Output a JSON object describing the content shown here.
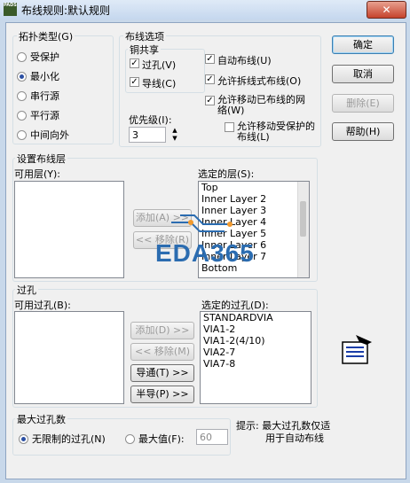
{
  "window": {
    "title": "布线规则:默认规则",
    "icon": "PADS"
  },
  "topology": {
    "title": "拓扑类型(G)",
    "options": [
      {
        "label": "受保护",
        "selected": false
      },
      {
        "label": "最小化",
        "selected": true
      },
      {
        "label": "串行源",
        "selected": false
      },
      {
        "label": "平行源",
        "selected": false
      },
      {
        "label": "中间向外",
        "selected": false
      }
    ]
  },
  "routing": {
    "title": "布线选项",
    "copper_share": {
      "title": "铜共享",
      "via_label": "过孔(V)",
      "via_checked": true,
      "trace_label": "导线(C)",
      "trace_checked": true
    },
    "priority_label": "优先级(I):",
    "priority_value": "3",
    "options": [
      {
        "label": "自动布线(U)",
        "checked": true
      },
      {
        "label": "允许拆线式布线(O)",
        "checked": true
      },
      {
        "label": "允许移动已布线的网络(W)",
        "checked": true
      },
      {
        "label": "允许移动受保护的布线(L)",
        "checked": false
      }
    ]
  },
  "buttons": {
    "ok": "确定",
    "cancel": "取消",
    "delete": "删除(E)",
    "help": "帮助(H)"
  },
  "layers": {
    "title": "设置布线层",
    "available_label": "可用层(Y):",
    "selected_label": "选定的层(S):",
    "add": "添加(A) >>",
    "remove": "<< 移除(R)",
    "selected": [
      "Top",
      "Inner Layer 2",
      "Inner Layer 3",
      "Inner Layer 4",
      "Inner Layer 5",
      "Inner Layer 6",
      "Inner Layer 7",
      "Bottom"
    ]
  },
  "watermark": "EDA365",
  "vias": {
    "title": "过孔",
    "available_label": "可用过孔(B):",
    "selected_label": "选定的过孔(D):",
    "add": "添加(D) >>",
    "remove": "<< 移除(M)",
    "through": "导通(T) >>",
    "partial": "半导(P) >>",
    "selected": [
      "STANDARDVIA",
      "VIA1-2",
      "VIA1-2(4/10)",
      "VIA2-7",
      "VIA7-8"
    ]
  },
  "max_vias": {
    "title": "最大过孔数",
    "unlimited": "无限制的过孔(N)",
    "unlimited_selected": true,
    "max_label": "最大值(F):",
    "max_value": "60"
  },
  "hint": {
    "line1": "提示: 最大过孔数仅适",
    "line2": "用于自动布线"
  }
}
